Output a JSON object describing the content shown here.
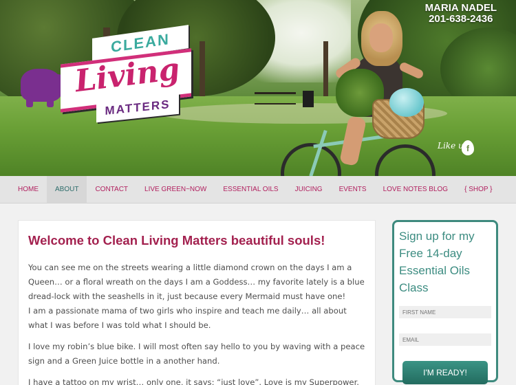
{
  "header": {
    "contact_name": "MARIA NADEL",
    "contact_phone": "201-638-2436",
    "like_us": "Like us",
    "logo": {
      "top": "CLEAN",
      "middle": "Living",
      "bottom": "MATTERS"
    }
  },
  "nav": {
    "items": [
      {
        "label": "HOME"
      },
      {
        "label": "ABOUT"
      },
      {
        "label": "CONTACT"
      },
      {
        "label": "LIVE GREEN~NOW"
      },
      {
        "label": "ESSENTIAL OILS"
      },
      {
        "label": "JUICING"
      },
      {
        "label": "EVENTS"
      },
      {
        "label": "LOVE NOTES BLOG"
      },
      {
        "label": "{ SHOP }"
      }
    ],
    "active_index": 1
  },
  "main": {
    "heading": "Welcome to Clean Living Matters beautiful souls!",
    "paragraphs": [
      "You can see me on the streets wearing a little diamond crown on the days I am a Queen… or a floral wreath on the days I am a Goddess… my favorite lately is a blue dread-lock with the seashells in it, just because every Mermaid must have one!",
      "I am a passionate mama of two girls who inspire and teach me daily… all about what I was before I was told what I should be.",
      "I love my robin’s blue bike.  I will most often say hello to you by waving with a peace sign and a Green Juice bottle in a another hand.",
      "I have a tattoo on my wrist… only one, it says: “just love”.  Love is my Superpower."
    ]
  },
  "sidebar": {
    "title": "Sign up for my Free 14-day Essential Oils Class",
    "first_name_placeholder": "FIRST NAME",
    "email_placeholder": "EMAIL",
    "button_label": "I'M READY!"
  },
  "colors": {
    "nav_text": "#b1205f",
    "nav_active_text": "#2e6d6b",
    "heading": "#a3214f",
    "accent_teal": "#3e8a7e"
  }
}
